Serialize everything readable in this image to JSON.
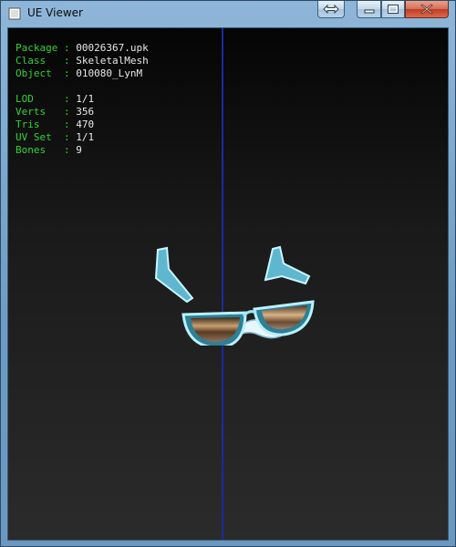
{
  "window": {
    "title": "UE Viewer",
    "buttons": [
      "swap-icon",
      "minimize-icon",
      "maximize-icon",
      "close-icon"
    ]
  },
  "info": {
    "group1": [
      {
        "label": "Package",
        "value": "00026367.upk"
      },
      {
        "label": "Class  ",
        "value": "SkeletalMesh"
      },
      {
        "label": "Object ",
        "value": "010080_LynM"
      }
    ],
    "group2": [
      {
        "label": "LOD    ",
        "value": "1/1"
      },
      {
        "label": "Verts  ",
        "value": "356"
      },
      {
        "label": "Tris   ",
        "value": "470"
      },
      {
        "label": "UV Set ",
        "value": "1/1"
      },
      {
        "label": "Bones  ",
        "value": "9"
      }
    ]
  },
  "colors": {
    "label": "#34d334",
    "value": "#e8e8e8",
    "axis": "#1c2a9a",
    "mesh_outline": "#7fe6ff"
  }
}
